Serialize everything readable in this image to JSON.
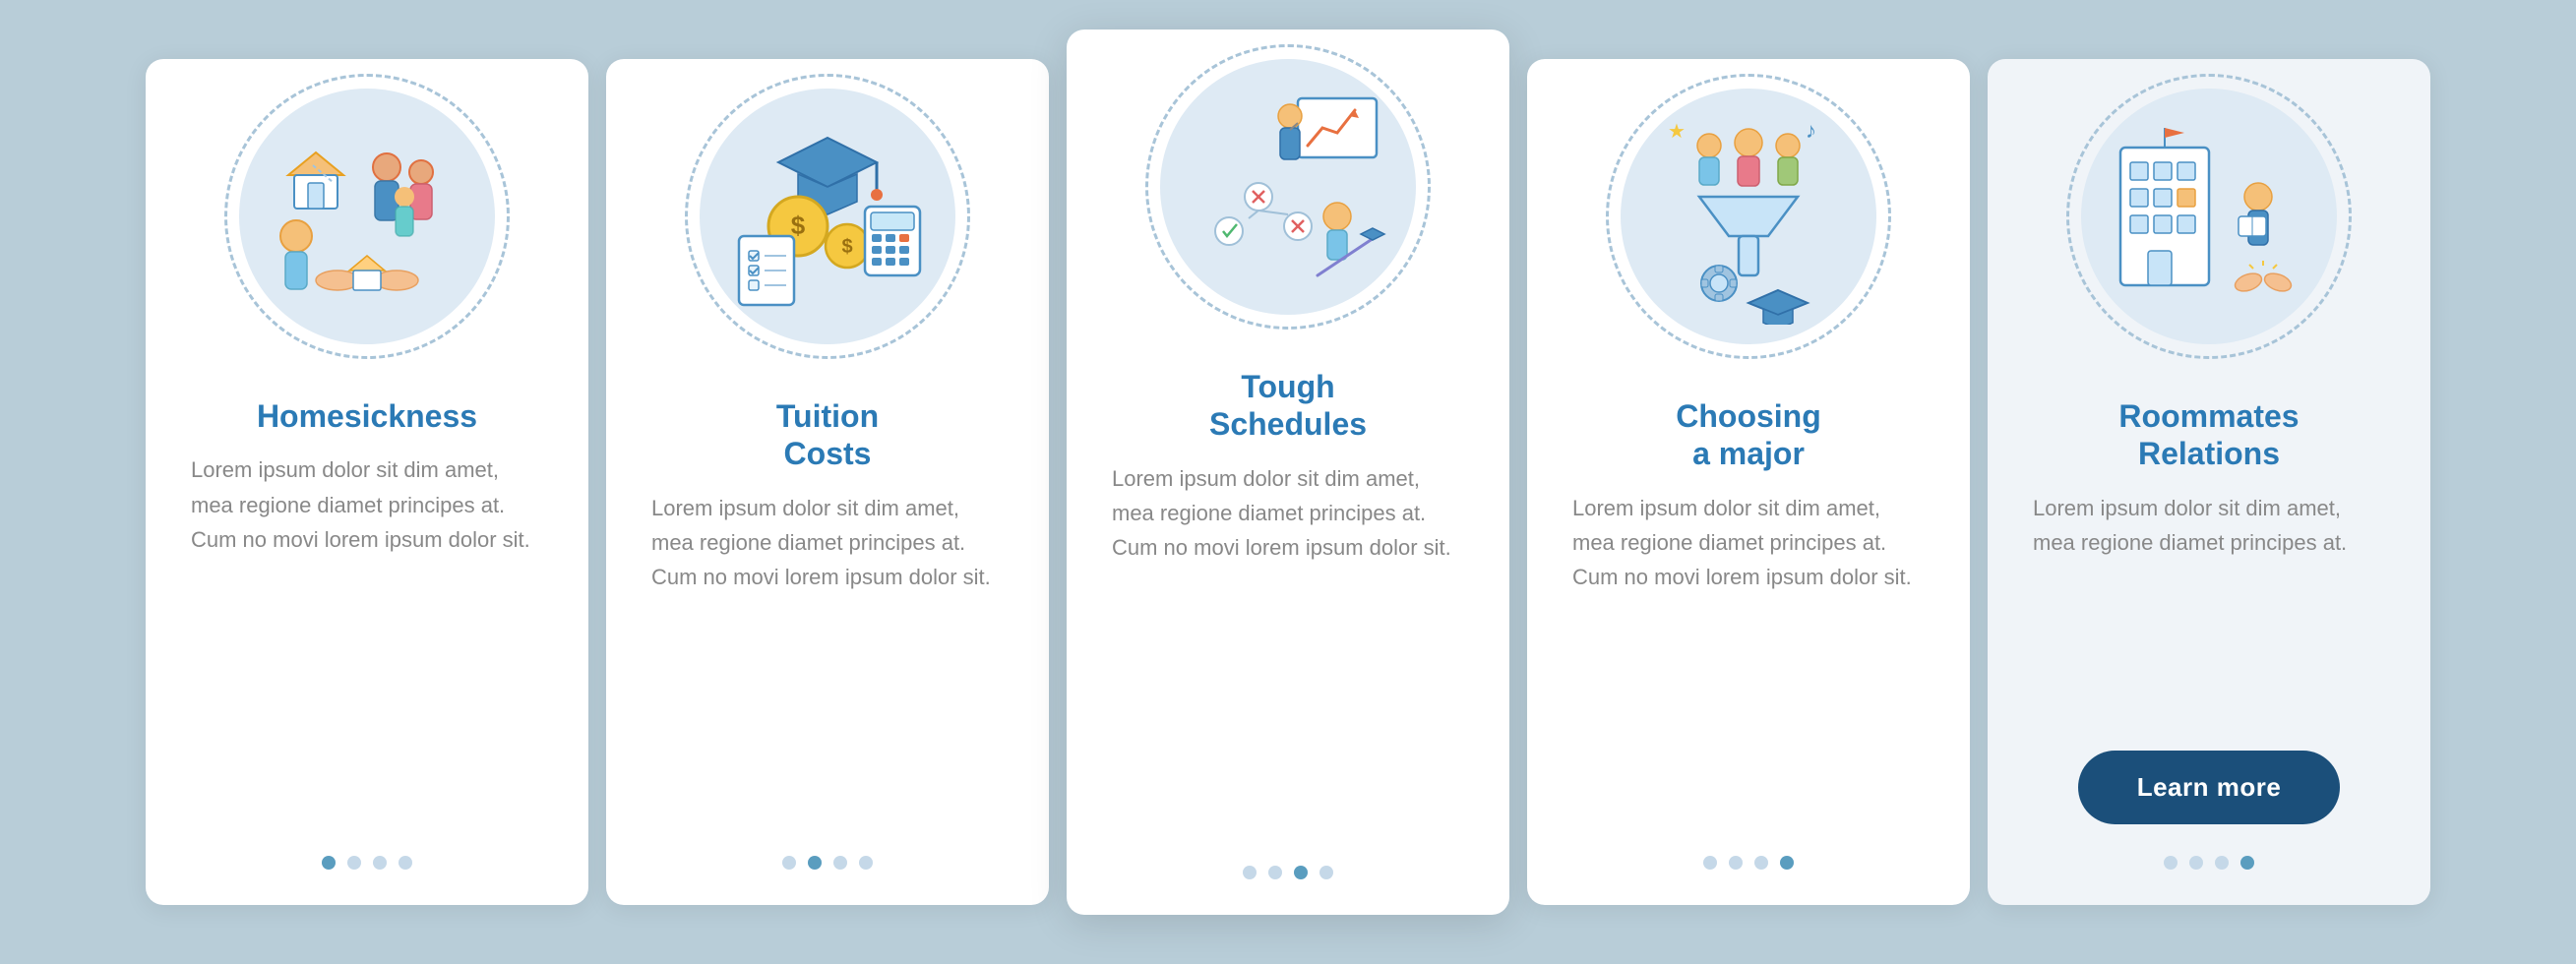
{
  "cards": [
    {
      "id": "homesickness",
      "title": "Homesickness",
      "text": "Lorem ipsum dolor sit dim amet, mea regione diamet principes at. Cum no movi lorem ipsum dolor sit.",
      "dots": [
        true,
        false,
        false,
        false
      ],
      "active_dot": 0,
      "button": null
    },
    {
      "id": "tuition-costs",
      "title": "Tuition\nCosts",
      "text": "Lorem ipsum dolor sit dim amet, mea regione diamet principes at. Cum no movi lorem ipsum dolor sit.",
      "dots": [
        false,
        true,
        false,
        false
      ],
      "active_dot": 1,
      "button": null
    },
    {
      "id": "tough-schedules",
      "title": "Tough\nSchedules",
      "text": "Lorem ipsum dolor sit dim amet, mea regione diamet principes at. Cum no movi lorem ipsum dolor sit.",
      "dots": [
        false,
        false,
        true,
        false
      ],
      "active_dot": 2,
      "button": null
    },
    {
      "id": "choosing-major",
      "title": "Choosing\na major",
      "text": "Lorem ipsum dolor sit dim amet, mea regione diamet principes at. Cum no movi lorem ipsum dolor sit.",
      "dots": [
        false,
        false,
        false,
        true
      ],
      "active_dot": 3,
      "button": null
    },
    {
      "id": "roommates-relations",
      "title": "Roommates\nRelations",
      "text": "Lorem ipsum dolor sit dim amet, mea regione diamet principes at.",
      "dots": [
        false,
        false,
        false,
        true
      ],
      "active_dot": 3,
      "button": "Learn more"
    }
  ]
}
